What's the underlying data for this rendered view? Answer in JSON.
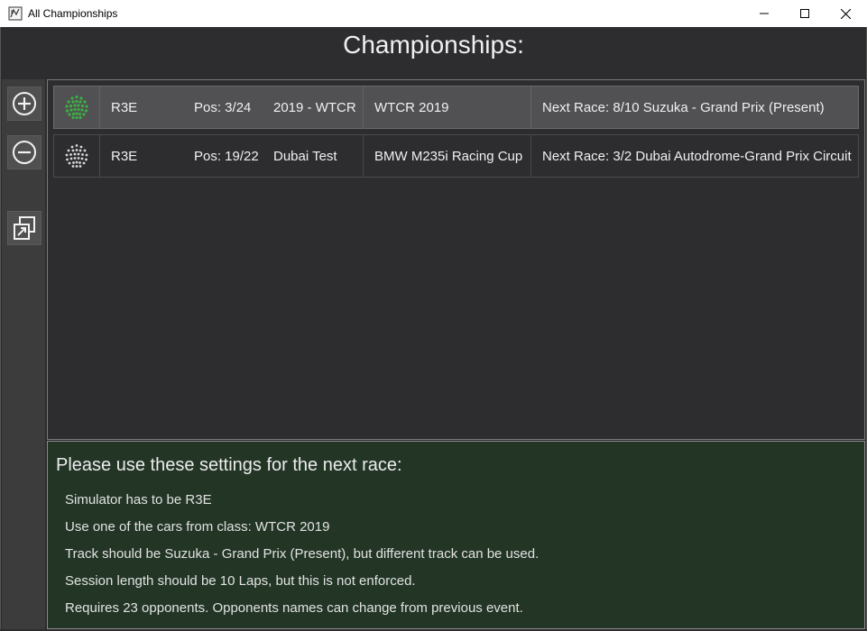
{
  "window": {
    "title": "All Championships",
    "icon": "app-logo-icon",
    "controls": [
      "minimize-icon",
      "maximize-icon",
      "close-icon"
    ]
  },
  "page": {
    "title": "Championships:"
  },
  "toolbar": {
    "buttons": [
      "add-circle-icon",
      "remove-circle-icon",
      "duplicate-icon"
    ]
  },
  "championships": [
    {
      "status_icon": "dotted-ball-green-icon",
      "simulator": "R3E",
      "position": "Pos: 3/24",
      "name": "2019 - WTCR",
      "car_class": "WTCR 2019",
      "next_race": "Next Race: 8/10 Suzuka - Grand Prix (Present)",
      "selected": true
    },
    {
      "status_icon": "dotted-ball-white-icon",
      "simulator": "R3E",
      "position": "Pos: 19/22",
      "name": "Dubai Test",
      "car_class": "BMW M235i Racing Cup",
      "next_race": "Next Race: 3/2 Dubai Autodrome-Grand Prix Circuit",
      "selected": false
    }
  ],
  "next_race_settings": {
    "header": "Please use these settings for the next race:",
    "lines": [
      "Simulator has to be R3E",
      "Use one of the cars from class: WTCR 2019",
      "Track should be Suzuka - Grand Prix (Present), but different track can be used.",
      "Session length should be 10 Laps, but this is not enforced.",
      "Requires 23 opponents. Opponents names can change from previous event."
    ]
  },
  "colors": {
    "background": "#2d2d30",
    "selected_row": "#515154",
    "settings_panel": "#233626",
    "status_green": "#3cb043",
    "status_white": "#d8d8d8"
  }
}
